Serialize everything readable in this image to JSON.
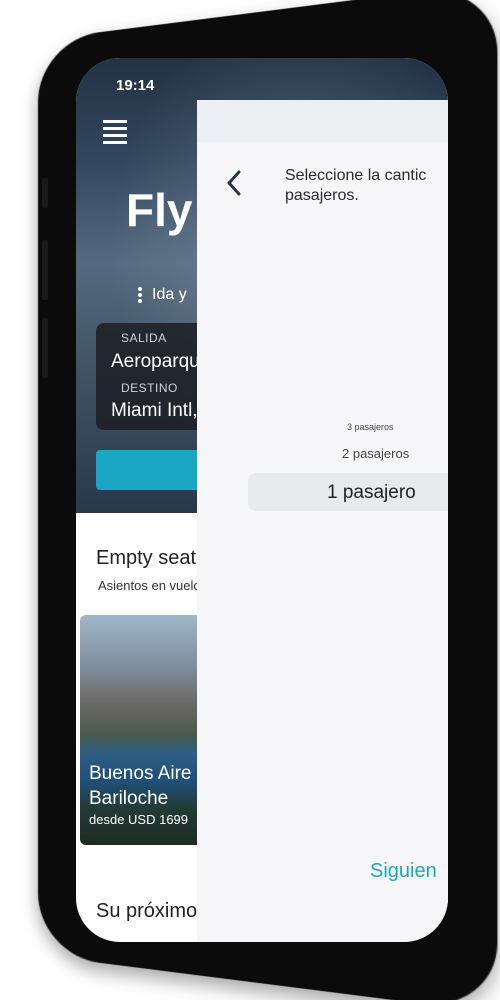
{
  "status_bar": {
    "time": "19:14"
  },
  "home": {
    "app_title": "Fly",
    "trip_type": "Ida y",
    "origin": {
      "label": "SALIDA",
      "value": "Aeroparqu"
    },
    "destination": {
      "label": "DESTINO",
      "value": "Miami Intl,"
    },
    "empty_seats": {
      "title": "Empty seat",
      "subtitle": "Asientos en vuelo"
    },
    "destination_card": {
      "line1": "Buenos Aire",
      "line2": "Bariloche",
      "price": "desde USD 1699"
    },
    "next_section_title": "Su próximo"
  },
  "passenger_selector": {
    "prompt": "Seleccione la cantic\npasajeros.",
    "options": [
      "3 pasajeros",
      "2 pasajeros",
      "1 pasajero"
    ],
    "selected": "1 pasajero",
    "next_label": "Siguien"
  },
  "colors": {
    "accent": "#1aa7c4",
    "panel_bg": "#f6f5f8",
    "frame": "#0b0b0b"
  }
}
